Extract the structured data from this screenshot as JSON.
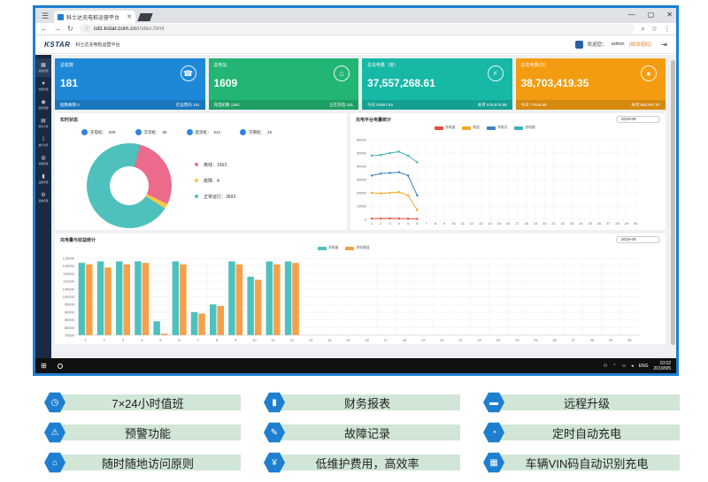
{
  "browser": {
    "tab_title": "科士达充电桩运营平台",
    "url_host": "cdz.kstar.com.cn",
    "url_path": "/index.html"
  },
  "header": {
    "logo": "KSTAR",
    "subtitle": "科士达充电桩运营平台",
    "welcome": "欢迎您：",
    "user": "admin",
    "switch": "(修改密码)"
  },
  "sidebar": {
    "items": [
      {
        "icon": "▦",
        "label": "系统监测"
      },
      {
        "icon": "♥",
        "label": "告警管理"
      },
      {
        "icon": "◉",
        "label": "运营管理"
      },
      {
        "icon": "▤",
        "label": "财务计费"
      },
      {
        "icon": "⟟",
        "label": "统计分析"
      },
      {
        "icon": "◍",
        "label": "基础管理"
      },
      {
        "icon": "▮",
        "label": "设备管理"
      },
      {
        "icon": "⚙",
        "label": "系统管理"
      }
    ]
  },
  "cards": [
    {
      "title": "总桩数",
      "value": "181",
      "foot_left": "桩数故障 0",
      "foot_right": "在运营的 181",
      "color": "#1e88d8",
      "icon": "☎"
    },
    {
      "title": "总电站",
      "value": "1609",
      "foot_left": "充电机数 1361",
      "foot_right": "正在充电 161",
      "color": "#23b574",
      "icon": "⌂"
    },
    {
      "title": "总充电量（度）",
      "value": "37,557,268.61",
      "foot_left": "今日 84907.84",
      "foot_right": "本月 578,975.99",
      "color": "#17b8a6",
      "icon": "⚡"
    },
    {
      "title": "总充电量(元)",
      "value": "38,703,419.35",
      "foot_left": "今日 77048.65",
      "foot_right": "本月 550,907.67",
      "color": "#f39c12",
      "icon": "●"
    }
  ],
  "realtime": {
    "title": "实时状态",
    "summary": [
      {
        "label": "充电桩：",
        "value": "609"
      },
      {
        "label": "交流桩：",
        "value": "55"
      },
      {
        "label": "直流桩：",
        "value": "512"
      },
      {
        "label": "交钢桩：",
        "value": "18"
      }
    ],
    "pie": [
      {
        "name": "离线",
        "value": 1563,
        "color": "#ec6a8c"
      },
      {
        "name": "故障",
        "value": 4,
        "color": "#f7c744"
      },
      {
        "name": "正常运行",
        "value": 3693,
        "color": "#4ec1bd"
      }
    ]
  },
  "line_panel": {
    "title": "充电平台电量统计",
    "date": "2019-09",
    "legend": [
      {
        "name": "充电量",
        "color": "#e74c3c"
      },
      {
        "name": "收益",
        "color": "#f5a623"
      },
      {
        "name": "充电次",
        "color": "#3b82c4"
      },
      {
        "name": "充电量",
        "color": "#3bb2b8"
      }
    ]
  },
  "bar_panel": {
    "title": "充电量与收益统计",
    "date": "2019-09",
    "legend": [
      {
        "name": "充电量",
        "color": "#4ec1bd"
      },
      {
        "name": "充电收益",
        "color": "#f5a04a"
      }
    ]
  },
  "chart_data": [
    {
      "type": "pie",
      "title": "实时状态",
      "categories": [
        "离线",
        "故障",
        "正常运行"
      ],
      "values": [
        1563,
        4,
        3693
      ]
    },
    {
      "type": "line",
      "title": "充电平台电量统计",
      "x": [
        1,
        2,
        3,
        4,
        5,
        6,
        7,
        8,
        9,
        10,
        11,
        12,
        13,
        14,
        15,
        16,
        17,
        18,
        19,
        20,
        21,
        22,
        23,
        24,
        25,
        26,
        27,
        28,
        29,
        30
      ],
      "ylim": [
        0,
        60000
      ],
      "yticks": [
        0,
        10000,
        20000,
        30000,
        40000,
        50000,
        60000
      ],
      "series": [
        {
          "name": "充电量",
          "color": "#3bb2b8",
          "values": [
            48000,
            48500,
            50000,
            51000,
            48000,
            43000
          ]
        },
        {
          "name": "充电次",
          "color": "#3b82c4",
          "values": [
            33000,
            34500,
            35000,
            35500,
            33000,
            18000
          ]
        },
        {
          "name": "收益",
          "color": "#f5a623",
          "values": [
            20000,
            19500,
            20000,
            20500,
            18000,
            7000
          ]
        },
        {
          "name": "充电量",
          "color": "#e74c3c",
          "values": [
            600,
            600,
            700,
            600,
            500,
            300
          ]
        }
      ]
    },
    {
      "type": "bar",
      "title": "充电量与收益统计",
      "categories": [
        "1",
        "2",
        "3",
        "4",
        "5",
        "6",
        "7",
        "8",
        "9",
        "10",
        "11",
        "12",
        "13",
        "14",
        "15",
        "16",
        "17",
        "18",
        "19",
        "20",
        "21",
        "22",
        "23",
        "24",
        "25",
        "26",
        "27",
        "28",
        "29",
        "30"
      ],
      "ylim": [
        75000,
        125000
      ],
      "yticks": [
        75000,
        80000,
        85000,
        90000,
        95000,
        100000,
        105000,
        110000,
        115000,
        120000,
        125000
      ],
      "series": [
        {
          "name": "充电量",
          "color": "#4ec1bd",
          "values": [
            122000,
            123000,
            123000,
            123000,
            84000,
            123000,
            90000,
            95000,
            123000,
            113000,
            123000,
            123000
          ]
        },
        {
          "name": "充电收益",
          "color": "#f5a04a",
          "values": [
            121000,
            119000,
            121000,
            122000,
            76000,
            121000,
            89000,
            94000,
            121000,
            111000,
            121000,
            122000
          ]
        }
      ]
    }
  ],
  "taskbar": {
    "lang": "ENG",
    "time": "10:02",
    "date": "2019/9/5"
  },
  "features": [
    [
      {
        "icon": "◷",
        "label": "7×24小时值班"
      },
      {
        "icon": "▮",
        "label": "财务报表"
      },
      {
        "icon": "▬",
        "label": "远程升级"
      }
    ],
    [
      {
        "icon": "⚠",
        "label": "预警功能"
      },
      {
        "icon": "✎",
        "label": "故障记录"
      },
      {
        "icon": "◔",
        "label": "定时自动充电"
      }
    ],
    [
      {
        "icon": "⌂",
        "label": "随时随地访问原则"
      },
      {
        "icon": "¥",
        "label": "低维护费用，高效率"
      },
      {
        "icon": "▦",
        "label": "车辆VIN码自动识别充电"
      }
    ]
  ]
}
